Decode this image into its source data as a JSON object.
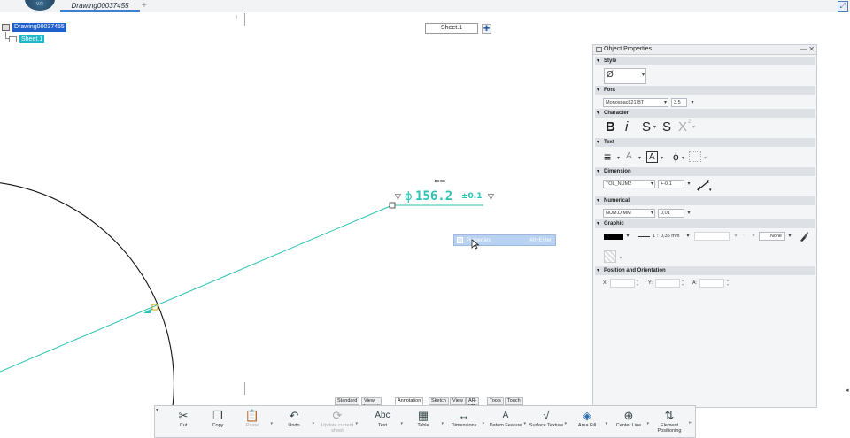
{
  "app": {
    "logo_text": "V.R",
    "document_tab": "Drawing00037455",
    "tab_add": "+",
    "corner_icon": "expand-icon"
  },
  "tree": {
    "collapse": "‹",
    "root_label": "Drawing00037455",
    "sheet_label": "Sheet.1"
  },
  "sheet_tab": {
    "label": "Sheet.1",
    "add": "✚"
  },
  "dimension": {
    "symbol": "ɸ",
    "value": "156.2",
    "tolerance": "±0.1",
    "arrow_left": "▽",
    "arrow_right": "▽",
    "move_handle": "⇐⇒"
  },
  "context_menu": {
    "label": "Properties",
    "shortcut": "Alt+Enter"
  },
  "properties_panel": {
    "title": "Object Properties",
    "min": "—",
    "close": "✕",
    "sections": {
      "style": "Style",
      "font": "Font",
      "character": "Character",
      "text": "Text",
      "dimension": "Dimension",
      "numerical": "Numerical",
      "graphic": "Graphic",
      "position": "Position and Orientation"
    },
    "style_symbol": "Ø",
    "font_name": "Monospac821 BT",
    "font_size": "3,5",
    "char_bold": "B",
    "char_italic": "i",
    "char_s1": "S",
    "char_s2": "S",
    "char_x": "X",
    "char_sup": "2",
    "text_align": "≡",
    "text_a": "A",
    "text_frame_a": "A",
    "text_phi": "ɸ",
    "dim_tolerance": "TOL_NUM2",
    "dim_value": "+-0,1",
    "num_format": "NUM.DIMM",
    "num_precision": "0,01",
    "graphic_color": "#000000",
    "graphic_scale": "1",
    "graphic_thickness": "0,35 mm",
    "graphic_fill": "None",
    "pos_x_label": "X:",
    "pos_y_label": "Y:",
    "pos_a_label": "A:"
  },
  "toolbar": {
    "tabs": [
      "Standard",
      "View Layout",
      "Annotation",
      "Sketch",
      "View",
      "AR-VR",
      "Tools",
      "Touch"
    ],
    "active_tab": "Annotation",
    "tools": [
      {
        "label": "Cut",
        "icon": "✂",
        "name": "cut"
      },
      {
        "label": "Copy",
        "icon": "❐",
        "name": "copy"
      },
      {
        "label": "Paste",
        "icon": "📋",
        "name": "paste"
      },
      {
        "label": "Undo",
        "icon": "↶",
        "name": "undo"
      },
      {
        "label": "Update current sheet",
        "icon": "⟳",
        "name": "update"
      },
      {
        "label": "Text",
        "icon": "Abc",
        "name": "text"
      },
      {
        "label": "Table",
        "icon": "▦",
        "name": "table"
      },
      {
        "label": "Dimensions",
        "icon": "↔",
        "name": "dimensions"
      },
      {
        "label": "Datum Feature",
        "icon": "A",
        "name": "datum"
      },
      {
        "label": "Surface Texture",
        "icon": "√",
        "name": "surface"
      },
      {
        "label": "Area Fill",
        "icon": "◈",
        "name": "area-fill"
      },
      {
        "label": "Center Line",
        "icon": "⊕",
        "name": "center-line"
      },
      {
        "label": "Element Positioning",
        "icon": "⇅",
        "name": "positioning"
      }
    ]
  }
}
